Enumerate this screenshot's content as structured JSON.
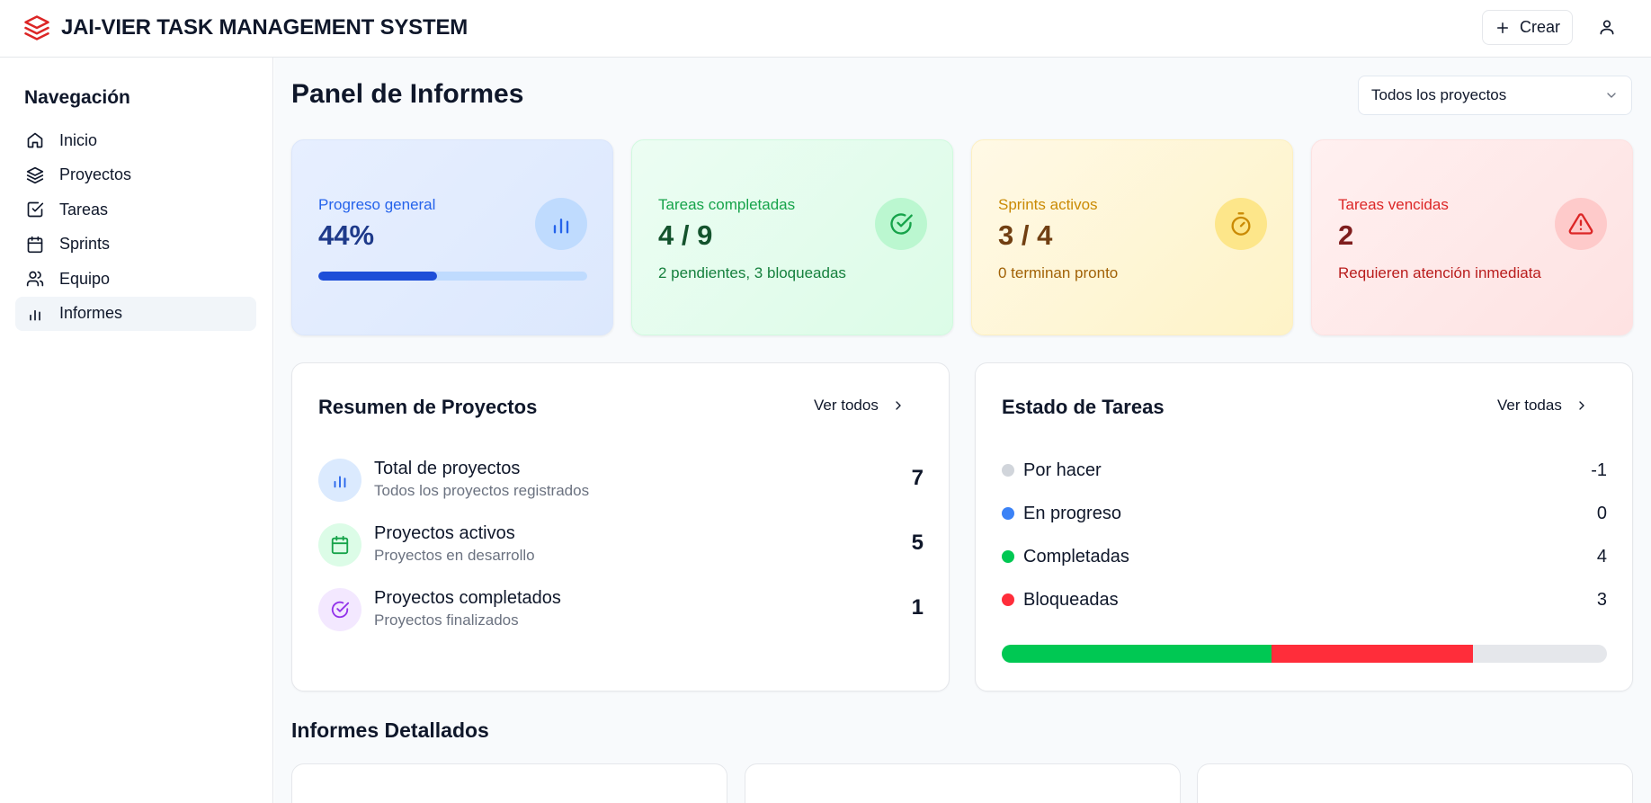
{
  "app": {
    "title": "JAI-VIER TASK MANAGEMENT SYSTEM",
    "create_label": "Crear",
    "brand_color": "#dc2626"
  },
  "sidebar": {
    "title": "Navegación",
    "items": [
      {
        "label": "Inicio",
        "icon": "home-icon"
      },
      {
        "label": "Proyectos",
        "icon": "layers-icon"
      },
      {
        "label": "Tareas",
        "icon": "check-square-icon"
      },
      {
        "label": "Sprints",
        "icon": "calendar-icon"
      },
      {
        "label": "Equipo",
        "icon": "users-icon"
      },
      {
        "label": "Informes",
        "icon": "bar-chart-icon",
        "active": true
      }
    ]
  },
  "main": {
    "title": "Panel de Informes",
    "project_filter": "Todos los proyectos",
    "stats": {
      "progress": {
        "label": "Progreso general",
        "value": "44%",
        "fraction": 0.44
      },
      "completed": {
        "label": "Tareas completadas",
        "value": "4 / 9",
        "sub": "2 pendientes, 3 bloqueadas"
      },
      "sprints": {
        "label": "Sprints activos",
        "value": "3 / 4",
        "sub": "0 terminan pronto"
      },
      "overdue": {
        "label": "Tareas vencidas",
        "value": "2",
        "sub": "Requieren atención inmediata"
      }
    },
    "projects_panel": {
      "title": "Resumen de Proyectos",
      "link": "Ver todos",
      "rows": [
        {
          "title": "Total de proyectos",
          "sub": "Todos los proyectos registrados",
          "value": "7",
          "icon": "bar-chart-icon"
        },
        {
          "title": "Proyectos activos",
          "sub": "Proyectos en desarrollo",
          "value": "5",
          "icon": "calendar-icon"
        },
        {
          "title": "Proyectos completados",
          "sub": "Proyectos finalizados",
          "value": "1",
          "icon": "check-circle-icon"
        }
      ]
    },
    "tasks_panel": {
      "title": "Estado de Tareas",
      "link": "Ver todas",
      "rows": [
        {
          "label": "Por hacer",
          "value": "-1",
          "color": "#d1d5db"
        },
        {
          "label": "En progreso",
          "value": "0",
          "color": "#3b82f6"
        },
        {
          "label": "Completadas",
          "value": "4",
          "color": "#00c853"
        },
        {
          "label": "Bloqueadas",
          "value": "3",
          "color": "#ff2d3a"
        }
      ],
      "bar": [
        {
          "name": "completadas",
          "fraction": 0.446,
          "color": "#00c853"
        },
        {
          "name": "bloqueadas",
          "fraction": 0.333,
          "color": "#ff2d3a"
        }
      ]
    },
    "detailed_title": "Informes Detallados"
  }
}
